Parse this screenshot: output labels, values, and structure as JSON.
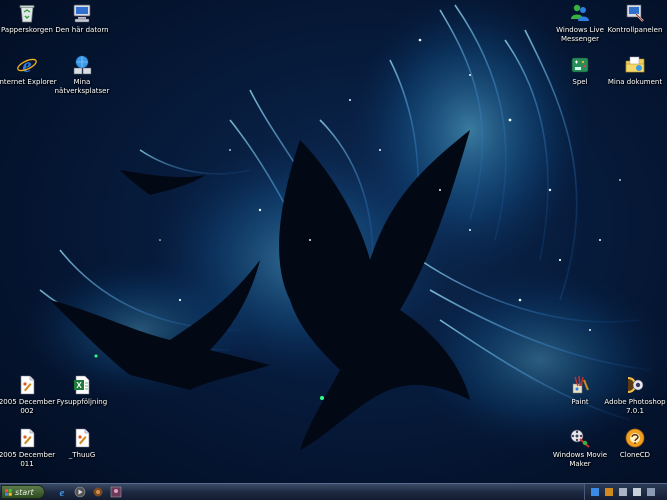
{
  "desktop": {
    "icons": [
      {
        "name": "recycle-bin",
        "label": "Papperskorgen",
        "icon": "recycle-bin-icon"
      },
      {
        "name": "my-computer",
        "label": "Den här datorn",
        "icon": "computer-icon"
      },
      {
        "name": "internet-explorer",
        "label": "Internet Explorer",
        "icon": "internet-explorer-icon"
      },
      {
        "name": "my-network-places",
        "label": "Mina nätverksplatser",
        "icon": "network-icon"
      },
      {
        "name": "windows-live-messenger",
        "label": "Windows Live Messenger",
        "icon": "messenger-icon"
      },
      {
        "name": "control-panel",
        "label": "Kontrollpanelen",
        "icon": "control-panel-icon"
      },
      {
        "name": "games",
        "label": "Spel",
        "icon": "games-icon"
      },
      {
        "name": "my-documents",
        "label": "Mina dokument",
        "icon": "documents-folder-icon"
      },
      {
        "name": "file-2005-december-002",
        "label": "2005 December 002",
        "icon": "image-file-icon"
      },
      {
        "name": "fysupptoljning",
        "label": "Fysuppföljning",
        "icon": "excel-file-icon"
      },
      {
        "name": "file-2005-december-011",
        "label": "2005 December 011",
        "icon": "image-file-icon"
      },
      {
        "name": "thuug",
        "label": "_ThuuG",
        "icon": "image-file-icon"
      },
      {
        "name": "paint",
        "label": "Paint",
        "icon": "paint-icon"
      },
      {
        "name": "adobe-photoshop",
        "label": "Adobe Photoshop 7.0.1",
        "icon": "photoshop-icon"
      },
      {
        "name": "windows-movie-maker",
        "label": "Windows Movie Maker",
        "icon": "movie-maker-icon"
      },
      {
        "name": "clonecd",
        "label": "CloneCD",
        "icon": "clonecd-icon"
      }
    ]
  },
  "taskbar": {
    "start_label": "start",
    "quick_launch": [
      "internet-explorer-icon",
      "media-player-icon",
      "show-desktop-icon",
      "messenger-icon"
    ],
    "tray_icons": [
      "network-icon",
      "volume-icon",
      "shield-icon",
      "speaker-icon",
      "clock-icon"
    ]
  },
  "colors": {
    "background": "#061a3a",
    "glow": "#4fc3ff",
    "taskbar": "#1c2840"
  }
}
